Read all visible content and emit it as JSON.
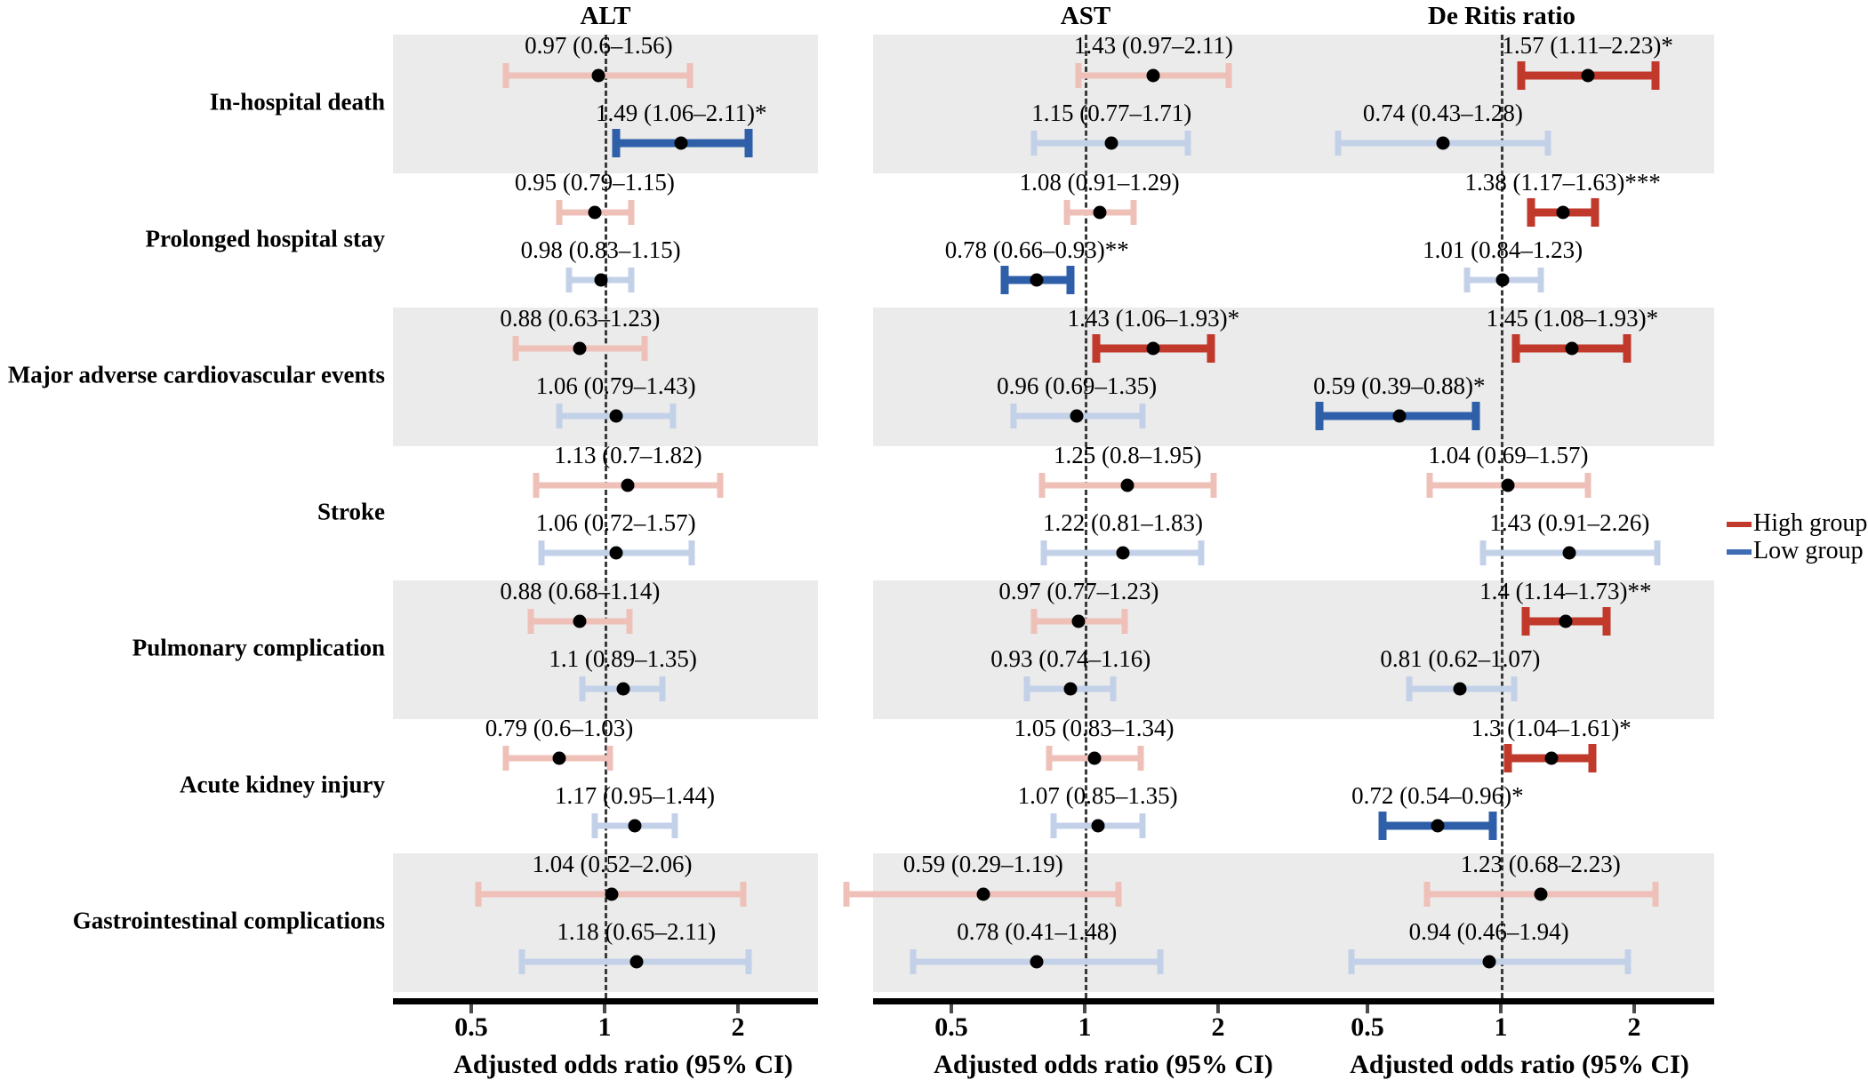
{
  "figure": {
    "type": "forest-plot",
    "x_axis_title": "Adjusted odds ratio (95% CI)",
    "x_ticks": [
      "0.5",
      "1",
      "2"
    ],
    "x_tick_values": [
      0.5,
      1,
      2
    ],
    "x_scale": "log2",
    "reference_line": 1
  },
  "panels": [
    {
      "title": "ALT"
    },
    {
      "title": "AST"
    },
    {
      "title": "De Ritis ratio"
    }
  ],
  "legend": {
    "position": "right-middle",
    "items": [
      {
        "label": "High group",
        "color": "#c0392b"
      },
      {
        "label": "Low group",
        "color": "#3f6cb5"
      }
    ]
  },
  "colors": {
    "high_significant": "#c0392b",
    "high_nonsignificant": "#eec0b8",
    "low_significant": "#2e5fa8",
    "low_nonsignificant": "#c3d1e8",
    "band": "#ebebeb",
    "point": "#000000"
  },
  "outcomes": [
    "In-hospital death",
    "Prolonged hospital stay",
    "Major adverse cardiovascular events",
    "Stroke",
    "Pulmonary complication",
    "Acute kidney injury",
    "Gastrointestinal complications"
  ],
  "chart_data": {
    "type": "forest",
    "title": "",
    "xlabel": "Adjusted odds ratio (95% CI)",
    "ylabel": "",
    "xscale": "log2",
    "xticks": [
      0.5,
      1,
      2
    ],
    "xlim": [
      0.28,
      2.4
    ],
    "reference_line": 1,
    "grid": false,
    "legend": [
      "High group",
      "Low group"
    ],
    "panels": [
      "ALT",
      "AST",
      "De Ritis ratio"
    ],
    "categories": [
      "In-hospital death",
      "Prolonged hospital stay",
      "Major adverse cardiovascular events",
      "Stroke",
      "Pulmonary complication",
      "Acute kidney injury",
      "Gastrointestinal complications"
    ],
    "rows": [
      {
        "outcome": "In-hospital death",
        "panels": [
          {
            "panel": "ALT",
            "series": [
              {
                "group": "High group",
                "or": 0.97,
                "lo": 0.6,
                "hi": 1.56,
                "sig": "",
                "label": "0.97 (0.6–1.56)"
              },
              {
                "group": "Low group",
                "or": 1.49,
                "lo": 1.06,
                "hi": 2.11,
                "sig": "*",
                "label": "1.49 (1.06–2.11)*"
              }
            ]
          },
          {
            "panel": "AST",
            "series": [
              {
                "group": "High group",
                "or": 1.43,
                "lo": 0.97,
                "hi": 2.11,
                "sig": "",
                "label": "1.43 (0.97–2.11)"
              },
              {
                "group": "Low group",
                "or": 1.15,
                "lo": 0.77,
                "hi": 1.71,
                "sig": "",
                "label": "1.15 (0.77–1.71)"
              }
            ]
          },
          {
            "panel": "De Ritis ratio",
            "series": [
              {
                "group": "High group",
                "or": 1.57,
                "lo": 1.11,
                "hi": 2.23,
                "sig": "*",
                "label": "1.57 (1.11–2.23)*"
              },
              {
                "group": "Low group",
                "or": 0.74,
                "lo": 0.43,
                "hi": 1.28,
                "sig": "",
                "label": "0.74 (0.43–1.28)"
              }
            ]
          }
        ]
      },
      {
        "outcome": "Prolonged hospital stay",
        "panels": [
          {
            "panel": "ALT",
            "series": [
              {
                "group": "High group",
                "or": 0.95,
                "lo": 0.79,
                "hi": 1.15,
                "sig": "",
                "label": "0.95 (0.79–1.15)"
              },
              {
                "group": "Low group",
                "or": 0.98,
                "lo": 0.83,
                "hi": 1.15,
                "sig": "",
                "label": "0.98 (0.83–1.15)"
              }
            ]
          },
          {
            "panel": "AST",
            "series": [
              {
                "group": "High group",
                "or": 1.08,
                "lo": 0.91,
                "hi": 1.29,
                "sig": "",
                "label": "1.08 (0.91–1.29)"
              },
              {
                "group": "Low group",
                "or": 0.78,
                "lo": 0.66,
                "hi": 0.93,
                "sig": "**",
                "label": "0.78 (0.66–0.93)**"
              }
            ]
          },
          {
            "panel": "De Ritis ratio",
            "series": [
              {
                "group": "High group",
                "or": 1.38,
                "lo": 1.17,
                "hi": 1.63,
                "sig": "***",
                "label": "1.38 (1.17–1.63)***"
              },
              {
                "group": "Low group",
                "or": 1.01,
                "lo": 0.84,
                "hi": 1.23,
                "sig": "",
                "label": "1.01 (0.84–1.23)"
              }
            ]
          }
        ]
      },
      {
        "outcome": "Major adverse cardiovascular events",
        "panels": [
          {
            "panel": "ALT",
            "series": [
              {
                "group": "High group",
                "or": 0.88,
                "lo": 0.63,
                "hi": 1.23,
                "sig": "",
                "label": "0.88 (0.63–1.23)"
              },
              {
                "group": "Low group",
                "or": 1.06,
                "lo": 0.79,
                "hi": 1.43,
                "sig": "",
                "label": "1.06 (0.79–1.43)"
              }
            ]
          },
          {
            "panel": "AST",
            "series": [
              {
                "group": "High group",
                "or": 1.43,
                "lo": 1.06,
                "hi": 1.93,
                "sig": "*",
                "label": "1.43 (1.06–1.93)*"
              },
              {
                "group": "Low group",
                "or": 0.96,
                "lo": 0.69,
                "hi": 1.35,
                "sig": "",
                "label": "0.96 (0.69–1.35)"
              }
            ]
          },
          {
            "panel": "De Ritis ratio",
            "series": [
              {
                "group": "High group",
                "or": 1.45,
                "lo": 1.08,
                "hi": 1.93,
                "sig": "*",
                "label": "1.45 (1.08–1.93)*"
              },
              {
                "group": "Low group",
                "or": 0.59,
                "lo": 0.39,
                "hi": 0.88,
                "sig": "*",
                "label": "0.59 (0.39–0.88)*"
              }
            ]
          }
        ]
      },
      {
        "outcome": "Stroke",
        "panels": [
          {
            "panel": "ALT",
            "series": [
              {
                "group": "High group",
                "or": 1.13,
                "lo": 0.7,
                "hi": 1.82,
                "sig": "",
                "label": "1.13 (0.7–1.82)"
              },
              {
                "group": "Low group",
                "or": 1.06,
                "lo": 0.72,
                "hi": 1.57,
                "sig": "",
                "label": "1.06 (0.72–1.57)"
              }
            ]
          },
          {
            "panel": "AST",
            "series": [
              {
                "group": "High group",
                "or": 1.25,
                "lo": 0.8,
                "hi": 1.95,
                "sig": "",
                "label": "1.25 (0.8–1.95)"
              },
              {
                "group": "Low group",
                "or": 1.22,
                "lo": 0.81,
                "hi": 1.83,
                "sig": "",
                "label": "1.22 (0.81–1.83)"
              }
            ]
          },
          {
            "panel": "De Ritis ratio",
            "series": [
              {
                "group": "High group",
                "or": 1.04,
                "lo": 0.69,
                "hi": 1.57,
                "sig": "",
                "label": "1.04 (0.69–1.57)"
              },
              {
                "group": "Low group",
                "or": 1.43,
                "lo": 0.91,
                "hi": 2.26,
                "sig": "",
                "label": "1.43 (0.91–2.26)"
              }
            ]
          }
        ]
      },
      {
        "outcome": "Pulmonary complication",
        "panels": [
          {
            "panel": "ALT",
            "series": [
              {
                "group": "High group",
                "or": 0.88,
                "lo": 0.68,
                "hi": 1.14,
                "sig": "",
                "label": "0.88 (0.68–1.14)"
              },
              {
                "group": "Low group",
                "or": 1.1,
                "lo": 0.89,
                "hi": 1.35,
                "sig": "",
                "label": "1.1 (0.89–1.35)"
              }
            ]
          },
          {
            "panel": "AST",
            "series": [
              {
                "group": "High group",
                "or": 0.97,
                "lo": 0.77,
                "hi": 1.23,
                "sig": "",
                "label": "0.97 (0.77–1.23)"
              },
              {
                "group": "Low group",
                "or": 0.93,
                "lo": 0.74,
                "hi": 1.16,
                "sig": "",
                "label": "0.93 (0.74–1.16)"
              }
            ]
          },
          {
            "panel": "De Ritis ratio",
            "series": [
              {
                "group": "High group",
                "or": 1.4,
                "lo": 1.14,
                "hi": 1.73,
                "sig": "**",
                "label": "1.4 (1.14–1.73)**"
              },
              {
                "group": "Low group",
                "or": 0.81,
                "lo": 0.62,
                "hi": 1.07,
                "sig": "",
                "label": "0.81 (0.62–1.07)"
              }
            ]
          }
        ]
      },
      {
        "outcome": "Acute kidney injury",
        "panels": [
          {
            "panel": "ALT",
            "series": [
              {
                "group": "High group",
                "or": 0.79,
                "lo": 0.6,
                "hi": 1.03,
                "sig": "",
                "label": "0.79 (0.6–1.03)"
              },
              {
                "group": "Low group",
                "or": 1.17,
                "lo": 0.95,
                "hi": 1.44,
                "sig": "",
                "label": "1.17 (0.95–1.44)"
              }
            ]
          },
          {
            "panel": "AST",
            "series": [
              {
                "group": "High group",
                "or": 1.05,
                "lo": 0.83,
                "hi": 1.34,
                "sig": "",
                "label": "1.05 (0.83–1.34)"
              },
              {
                "group": "Low group",
                "or": 1.07,
                "lo": 0.85,
                "hi": 1.35,
                "sig": "",
                "label": "1.07 (0.85–1.35)"
              }
            ]
          },
          {
            "panel": "De Ritis ratio",
            "series": [
              {
                "group": "High group",
                "or": 1.3,
                "lo": 1.04,
                "hi": 1.61,
                "sig": "*",
                "label": "1.3 (1.04–1.61)*"
              },
              {
                "group": "Low group",
                "or": 0.72,
                "lo": 0.54,
                "hi": 0.96,
                "sig": "*",
                "label": "0.72 (0.54–0.96)*"
              }
            ]
          }
        ]
      },
      {
        "outcome": "Gastrointestinal complications",
        "panels": [
          {
            "panel": "ALT",
            "series": [
              {
                "group": "High group",
                "or": 1.04,
                "lo": 0.52,
                "hi": 2.06,
                "sig": "",
                "label": "1.04 (0.52–2.06)"
              },
              {
                "group": "Low group",
                "or": 1.18,
                "lo": 0.65,
                "hi": 2.11,
                "sig": "",
                "label": "1.18 (0.65–2.11)"
              }
            ]
          },
          {
            "panel": "AST",
            "series": [
              {
                "group": "High group",
                "or": 0.59,
                "lo": 0.29,
                "hi": 1.19,
                "sig": "",
                "label": "0.59 (0.29–1.19)"
              },
              {
                "group": "Low group",
                "or": 0.78,
                "lo": 0.41,
                "hi": 1.48,
                "sig": "",
                "label": "0.78 (0.41–1.48)"
              }
            ]
          },
          {
            "panel": "De Ritis ratio",
            "series": [
              {
                "group": "High group",
                "or": 1.23,
                "lo": 0.68,
                "hi": 2.23,
                "sig": "",
                "label": "1.23 (0.68–2.23)"
              },
              {
                "group": "Low group",
                "or": 0.94,
                "lo": 0.46,
                "hi": 1.94,
                "sig": "",
                "label": "0.94 (0.46–1.94)"
              }
            ]
          }
        ]
      }
    ]
  }
}
